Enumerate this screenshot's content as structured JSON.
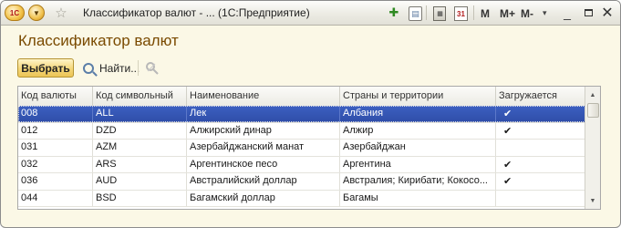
{
  "window": {
    "title": "Классификатор валют - ... (1С:Предприятие)",
    "logo_text": "1С",
    "m_buttons": [
      "M",
      "M+",
      "M-"
    ]
  },
  "icons": {
    "logo": "1c-logo-icon",
    "menu": "main-menu-icon",
    "favorite": "star-icon",
    "add_favorite": "add-to-favorites-icon",
    "bookmark": "bookmark-icon",
    "calculator": "calculator-icon",
    "calendar": "calendar-icon",
    "search": "magnifier-icon",
    "cancel_search": "cancel-search-icon"
  },
  "calendar_day": "31",
  "heading": "Классификатор валют",
  "toolbar": {
    "select_label": "Выбрать",
    "find_label": "Найти..."
  },
  "table": {
    "columns": [
      "Код валюты",
      "Код символьный",
      "Наименование",
      "Страны и территории",
      "Загружается"
    ],
    "rows": [
      {
        "code": "008",
        "symbol": "ALL",
        "name": "Лек",
        "countries": "Албания",
        "loaded": "✔"
      },
      {
        "code": "012",
        "symbol": "DZD",
        "name": "Алжирский динар",
        "countries": "Алжир",
        "loaded": "✔"
      },
      {
        "code": "031",
        "symbol": "AZM",
        "name": "Азербайджанский манат",
        "countries": "Азербайджан",
        "loaded": ""
      },
      {
        "code": "032",
        "symbol": "ARS",
        "name": "Аргентинское песо",
        "countries": "Аргентина",
        "loaded": "✔"
      },
      {
        "code": "036",
        "symbol": "AUD",
        "name": "Австралийский доллар",
        "countries": "Австралия; Кирибати; Кокосо...",
        "loaded": "✔"
      },
      {
        "code": "044",
        "symbol": "BSD",
        "name": "Багамский доллар",
        "countries": "Багамы",
        "loaded": ""
      }
    ],
    "selected_row": 0
  },
  "colors": {
    "accent": "#7a4a00",
    "selection": "#3356b5",
    "window_bg": "#fbf8e6"
  }
}
